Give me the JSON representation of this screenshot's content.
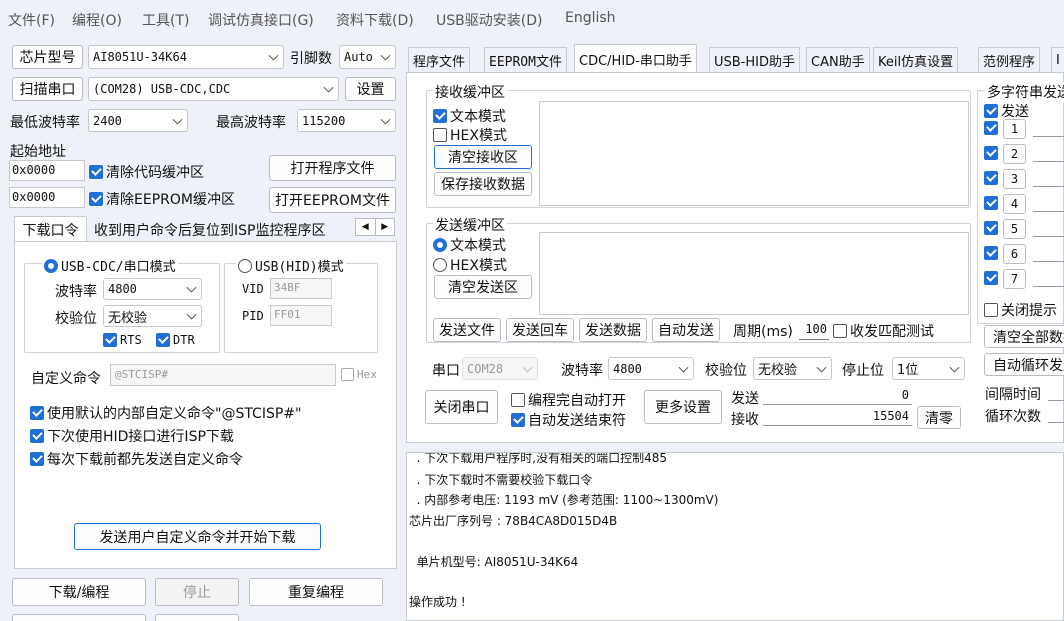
{
  "menu": [
    "文件(F)",
    "编程(O)",
    "工具(T)",
    "调试仿真接口(G)",
    "资料下载(D)",
    "USB驱动安装(D)",
    "English"
  ],
  "left": {
    "chip_btn": "芯片型号",
    "chip_value": "AI8051U-34K64",
    "pins_label": "引脚数",
    "pins_value": "Auto",
    "scan_btn": "扫描串口",
    "port_value": "(COM28) USB-CDC,CDC",
    "settings_btn": "设置",
    "min_baud_label": "最低波特率",
    "min_baud": "2400",
    "max_baud_label": "最高波特率",
    "max_baud": "115200",
    "start_addr_label": "起始地址",
    "addr1": "0x0000",
    "clear_code": "清除代码缓冲区",
    "open_prog_btn": "打开程序文件",
    "addr2": "0x0000",
    "clear_eeprom": "清除EEPROM缓冲区",
    "open_eeprom_btn": "打开EEPROM文件",
    "tab_download": "下载口令",
    "tab_reset": "收到用户命令后复位到ISP监控程序区",
    "mode_usbcdc": "USB-CDC/串口模式",
    "mode_usbhid": "USB(HID)模式",
    "baud_label": "波特率",
    "baud_value": "4800",
    "vid_label": "VID",
    "vid_value": "34BF",
    "parity_label": "校验位",
    "parity_value": "无校验",
    "pid_label": "PID",
    "pid_value": "FF01",
    "rts": "RTS",
    "dtr": "DTR",
    "custom_cmd_label": "自定义命令",
    "custom_cmd_value": "@STCISP#",
    "hex": "Hex",
    "opt1": "使用默认的内部自定义命令\"@STCISP#\"",
    "opt2": "下次使用HID接口进行ISP下载",
    "opt3": "每次下载前都先发送自定义命令",
    "send_custom_btn": "发送用户自定义命令并开始下载",
    "download_btn": "下载/编程",
    "stop_btn": "停止",
    "reprog_btn": "重复编程"
  },
  "tabs": [
    "程序文件",
    "EEPROM文件",
    "CDC/HID-串口助手",
    "USB-HID助手",
    "CAN助手",
    "Keil仿真设置",
    "范例程序",
    "I"
  ],
  "serial": {
    "recv_title": "接收缓冲区",
    "text_mode": "文本模式",
    "hex_mode": "HEX模式",
    "clear_recv": "清空接收区",
    "save_recv": "保存接收数据",
    "send_title": "发送缓冲区",
    "clear_send": "清空发送区",
    "send_file": "发送文件",
    "send_enter": "发送回车",
    "send_data": "发送数据",
    "auto_send": "自动发送",
    "period_label": "周期(ms)",
    "period_value": "100",
    "match_test": "收发匹配测试",
    "port_label": "串口",
    "port_value": "COM28",
    "baud_label": "波特率",
    "baud_value": "4800",
    "parity_label": "校验位",
    "parity_value": "无校验",
    "stop_label": "停止位",
    "stop_value": "1位",
    "close_port": "关闭串口",
    "auto_open": "编程完自动打开",
    "auto_end": "自动发送结束符",
    "more": "更多设置",
    "send_label": "发送",
    "send_count": "0",
    "recv_label": "接收",
    "recv_count": "15504",
    "clear_count": "清零",
    "multi_title": "多字符串发送",
    "multi_send": "发送",
    "rows": [
      "1",
      "2",
      "3",
      "4",
      "5",
      "6",
      "7"
    ],
    "close_tip": "关闭提示",
    "clear_all": "清空全部数据",
    "auto_loop": "自动循环发送",
    "interval": "间隔时间",
    "loop_count": "循环次数"
  },
  "log": [
    "  . 下次下载用户程序时,没有相关的端口控制485",
    "  . 下次下载时不需要校验下载口令",
    "  . 内部参考电压: 1193 mV (参考范围: 1100~1300mV)",
    "芯片出厂序列号 : 78B4CA8D015D4B",
    "",
    "  单片机型号: AI8051U-34K64",
    "",
    "操作成功 !"
  ]
}
